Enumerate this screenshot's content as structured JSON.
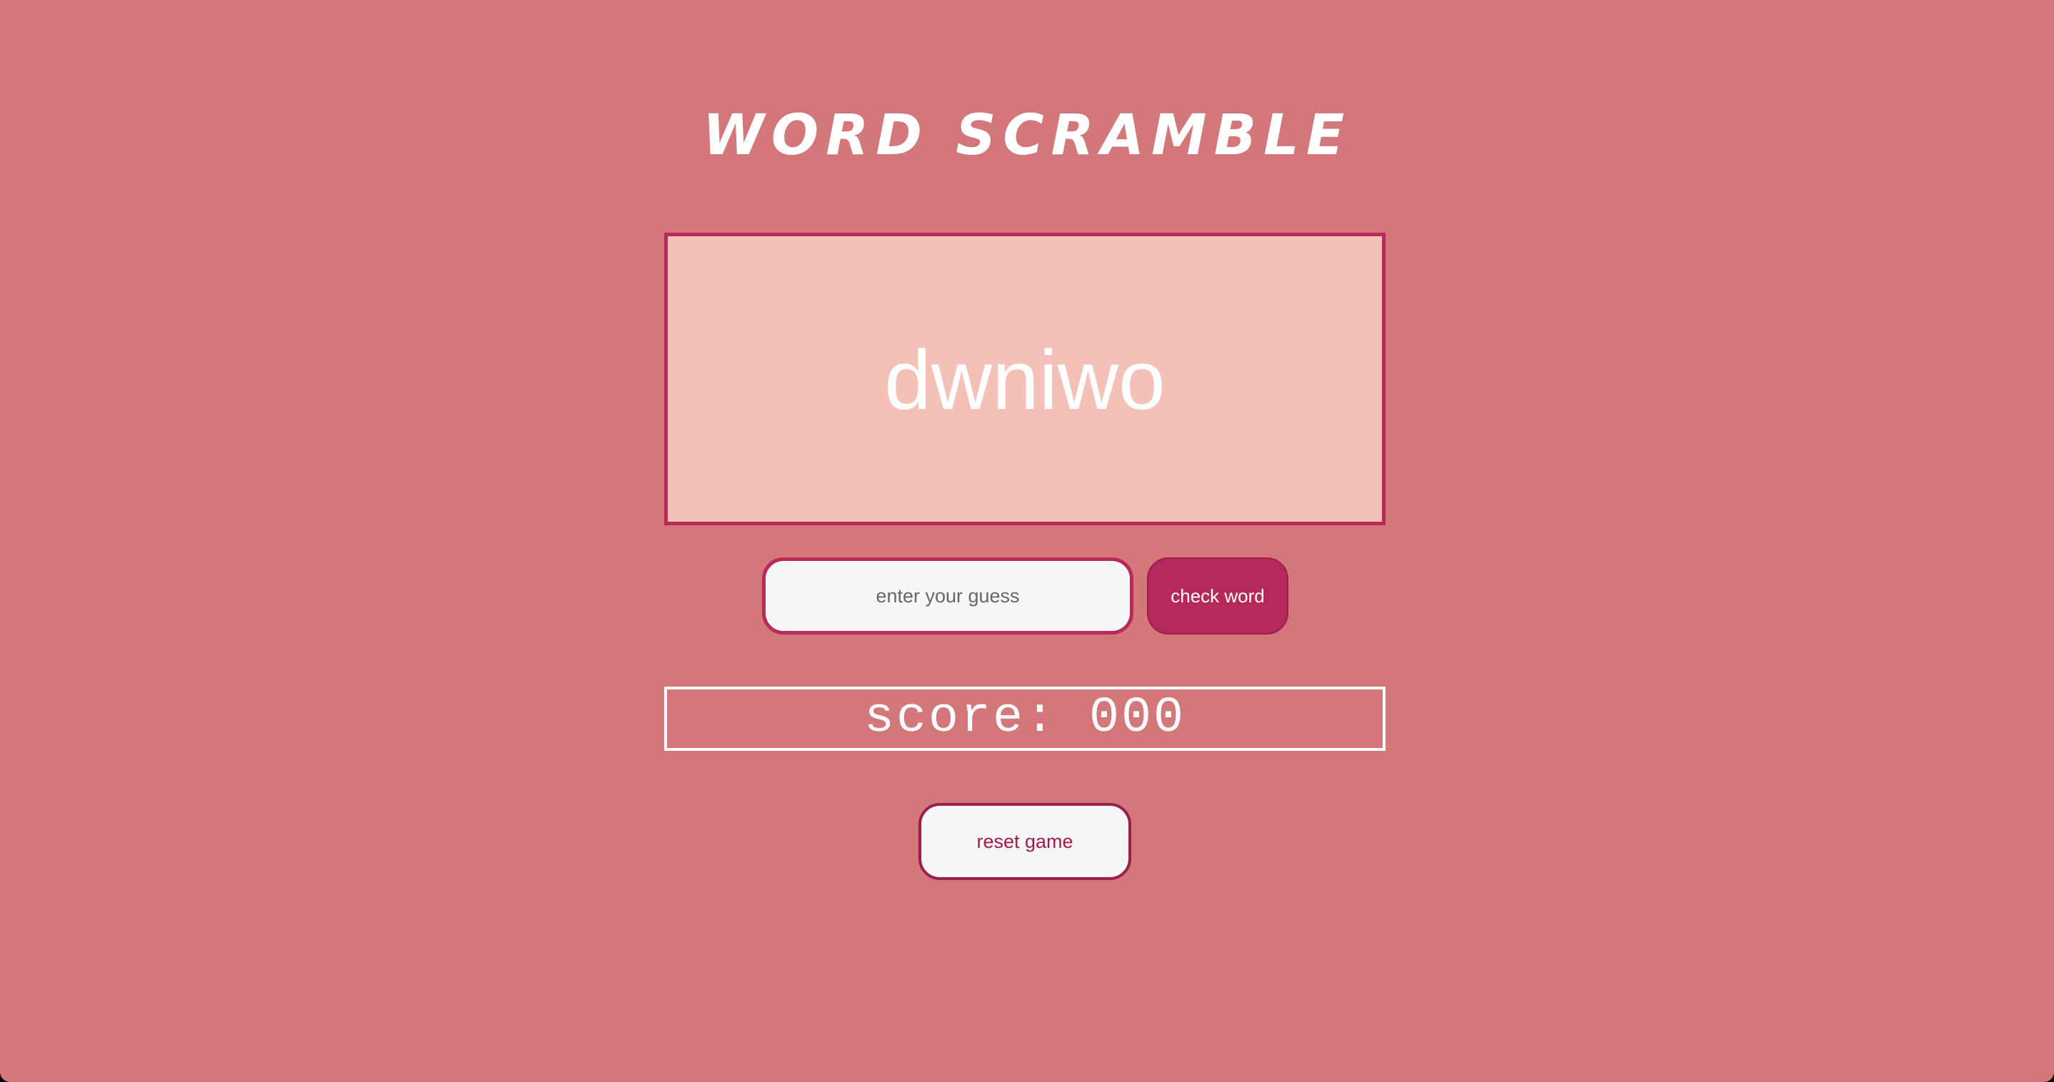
{
  "app": {
    "title": "WORD SCRAMBLE"
  },
  "game": {
    "scrambled_word": "dwniwo"
  },
  "guess": {
    "value": "",
    "placeholder": "enter your guess"
  },
  "buttons": {
    "check_label": "check word",
    "reset_label": "reset game"
  },
  "score": {
    "display": "score: 000"
  },
  "colors": {
    "background": "#d3777b",
    "word_box_fill": "#f4c1b8",
    "accent": "#b5285a",
    "text": "#ffffff"
  }
}
